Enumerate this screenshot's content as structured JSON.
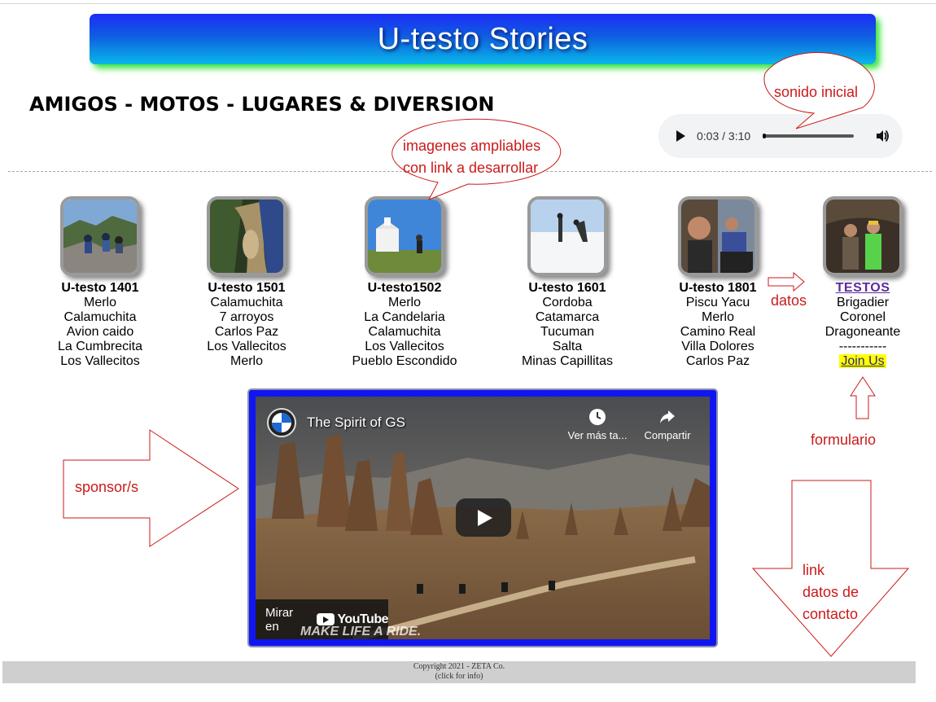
{
  "banner": {
    "title": "U-testo Stories"
  },
  "subtitle": "AMIGOS - MOTOS - LUGARES & DIVERSION",
  "audio": {
    "time": "0:03 / 3:10",
    "progress": 0.016
  },
  "cards": [
    {
      "title": "U-testo 1401",
      "lines": [
        "Merlo",
        "Calamuchita",
        "Avion caido",
        "La Cumbrecita",
        "Los Vallecitos"
      ]
    },
    {
      "title": "U-testo 1501",
      "lines": [
        "Calamuchita",
        "7 arroyos",
        "Carlos Paz",
        "Los Vallecitos",
        "Merlo"
      ]
    },
    {
      "title": "U-testo1502",
      "lines": [
        "Merlo",
        "La Candelaria",
        "Calamuchita",
        "Los Vallecitos",
        "Pueblo Escondido"
      ]
    },
    {
      "title": "U-testo 1601",
      "lines": [
        "Cordoba",
        "Catamarca",
        "Tucuman",
        "Salta",
        "Minas Capillitas"
      ]
    },
    {
      "title": "U-testo 1801",
      "lines": [
        "Piscu Yacu",
        "Merlo",
        "Camino Real",
        "Villa Dolores",
        "Carlos Paz"
      ]
    },
    {
      "title": "TESTOS",
      "lines": [
        "Brigadier",
        "Coronel",
        "Dragoneante",
        "-----------"
      ],
      "link": "Join Us"
    }
  ],
  "video": {
    "title": "The Spirit of GS",
    "watch_later": "Ver más ta...",
    "share": "Compartir",
    "watch_on": "Mirar en",
    "youtube": "YouTube",
    "slogan": "MAKE LIFE A RIDE."
  },
  "footer": {
    "line1": "Copyright 2021 - ZETA Co.",
    "line2": "(click for info)"
  },
  "annotations": {
    "sonido": "sonido inicial",
    "imagenes_1": "imagenes ampliables",
    "imagenes_2": "con link a desarrollar",
    "datos": "datos",
    "formulario": "formulario",
    "sponsor": "sponsor/s",
    "link_1": "link",
    "link_2": "datos de",
    "link_3": "contacto"
  },
  "colors": {
    "banner_top": "#1c2cf6",
    "banner_bottom": "#09b8e8",
    "banner_glow": "#37e53a",
    "annotation": "#cc1a1a",
    "video_frame": "#1016f2",
    "join_highlight": "#ffff00"
  }
}
